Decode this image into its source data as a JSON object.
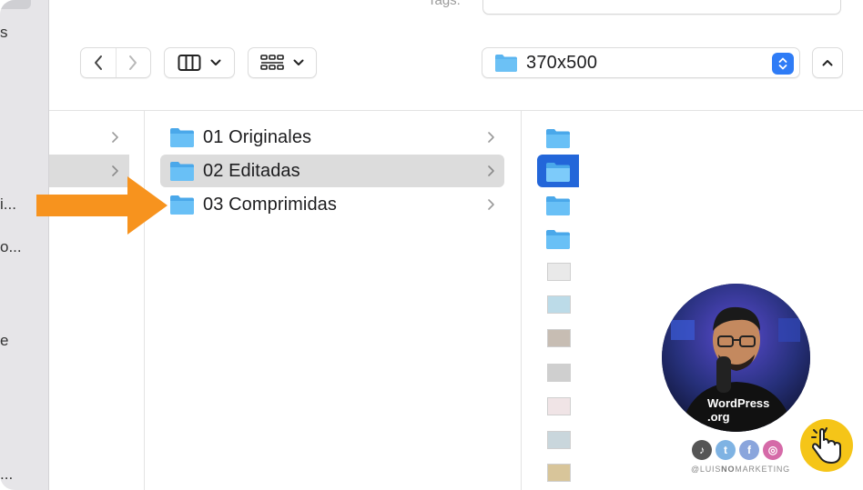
{
  "sidebar": {
    "fragments": [
      "s",
      "i...",
      "o...",
      "e",
      "..."
    ]
  },
  "header": {
    "tags_label": "Tags:",
    "tags_value": ""
  },
  "toolbar": {
    "path_folder": "370x500"
  },
  "browser": {
    "middle_column": {
      "items": [
        {
          "label": "01 Originales",
          "selected": false
        },
        {
          "label": "02 Editadas",
          "selected": true
        },
        {
          "label": "03 Comprimidas",
          "selected": false
        }
      ]
    },
    "right_column": {
      "folder_count": 4,
      "image_count": 7
    }
  },
  "overlay": {
    "shirt_text": "WordPress",
    "shirt_text_2": ".org",
    "handle_prefix": "@LUIS",
    "handle_mid": "NO",
    "handle_suffix": "MARKETING",
    "social_icons": [
      "tiktok-icon",
      "twitter-icon",
      "facebook-icon",
      "instagram-icon"
    ]
  },
  "colors": {
    "accent_blue": "#2f7cf6",
    "folder_blue": "#5bb5f0",
    "arrow_orange": "#f7931e",
    "selection_gray": "#dcdcdc"
  }
}
